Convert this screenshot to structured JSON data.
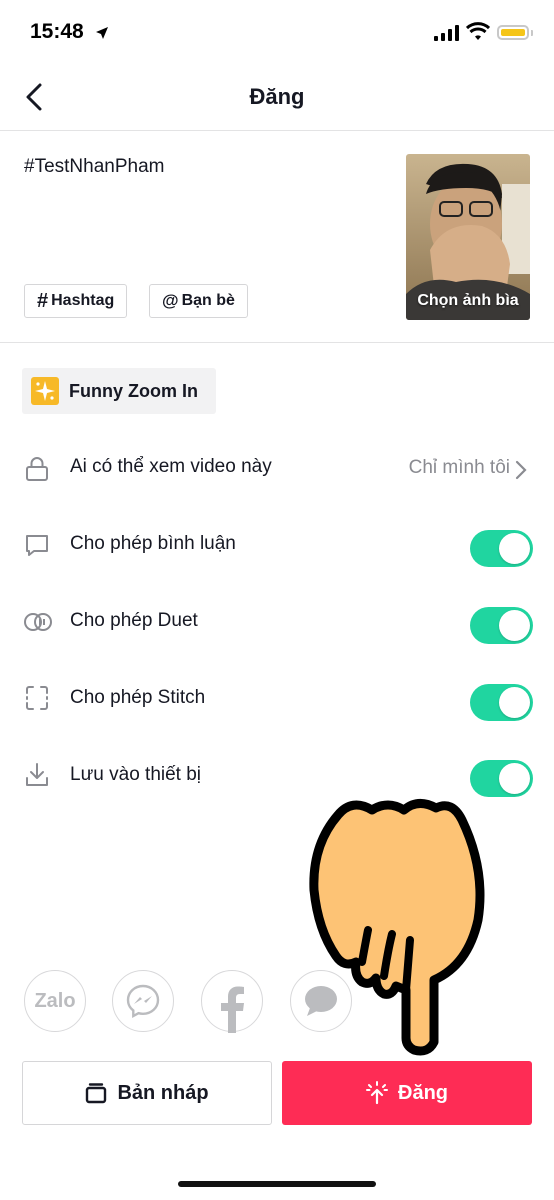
{
  "status_bar": {
    "time": "15:48"
  },
  "header": {
    "title": "Đăng"
  },
  "caption": {
    "text": "#TestNhanPham"
  },
  "chips": {
    "hashtag": "Hashtag",
    "friends": "Bạn bè",
    "hashtag_symbol": "#",
    "friends_symbol": "@"
  },
  "cover": {
    "label": "Chọn ảnh bìa"
  },
  "effect": {
    "label": "Funny Zoom In"
  },
  "settings": [
    {
      "label": "Ai có thể xem video này",
      "value": "Chỉ mình tôi",
      "icon": "lock-icon"
    },
    {
      "label": "Cho phép bình luận",
      "toggle": true,
      "icon": "comment-icon"
    },
    {
      "label": "Cho phép Duet",
      "toggle": true,
      "icon": "duet-icon"
    },
    {
      "label": "Cho phép Stitch",
      "toggle": true,
      "icon": "stitch-icon"
    },
    {
      "label": "Lưu vào thiết bị",
      "toggle": true,
      "icon": "download-icon"
    }
  ],
  "share": {
    "zalo": "Zalo"
  },
  "actions": {
    "draft": "Bản nháp",
    "post": "Đăng"
  },
  "colors": {
    "accent": "#fe2c55",
    "toggle_on": "#20d5a0",
    "effect_icon": "#f7b928"
  }
}
